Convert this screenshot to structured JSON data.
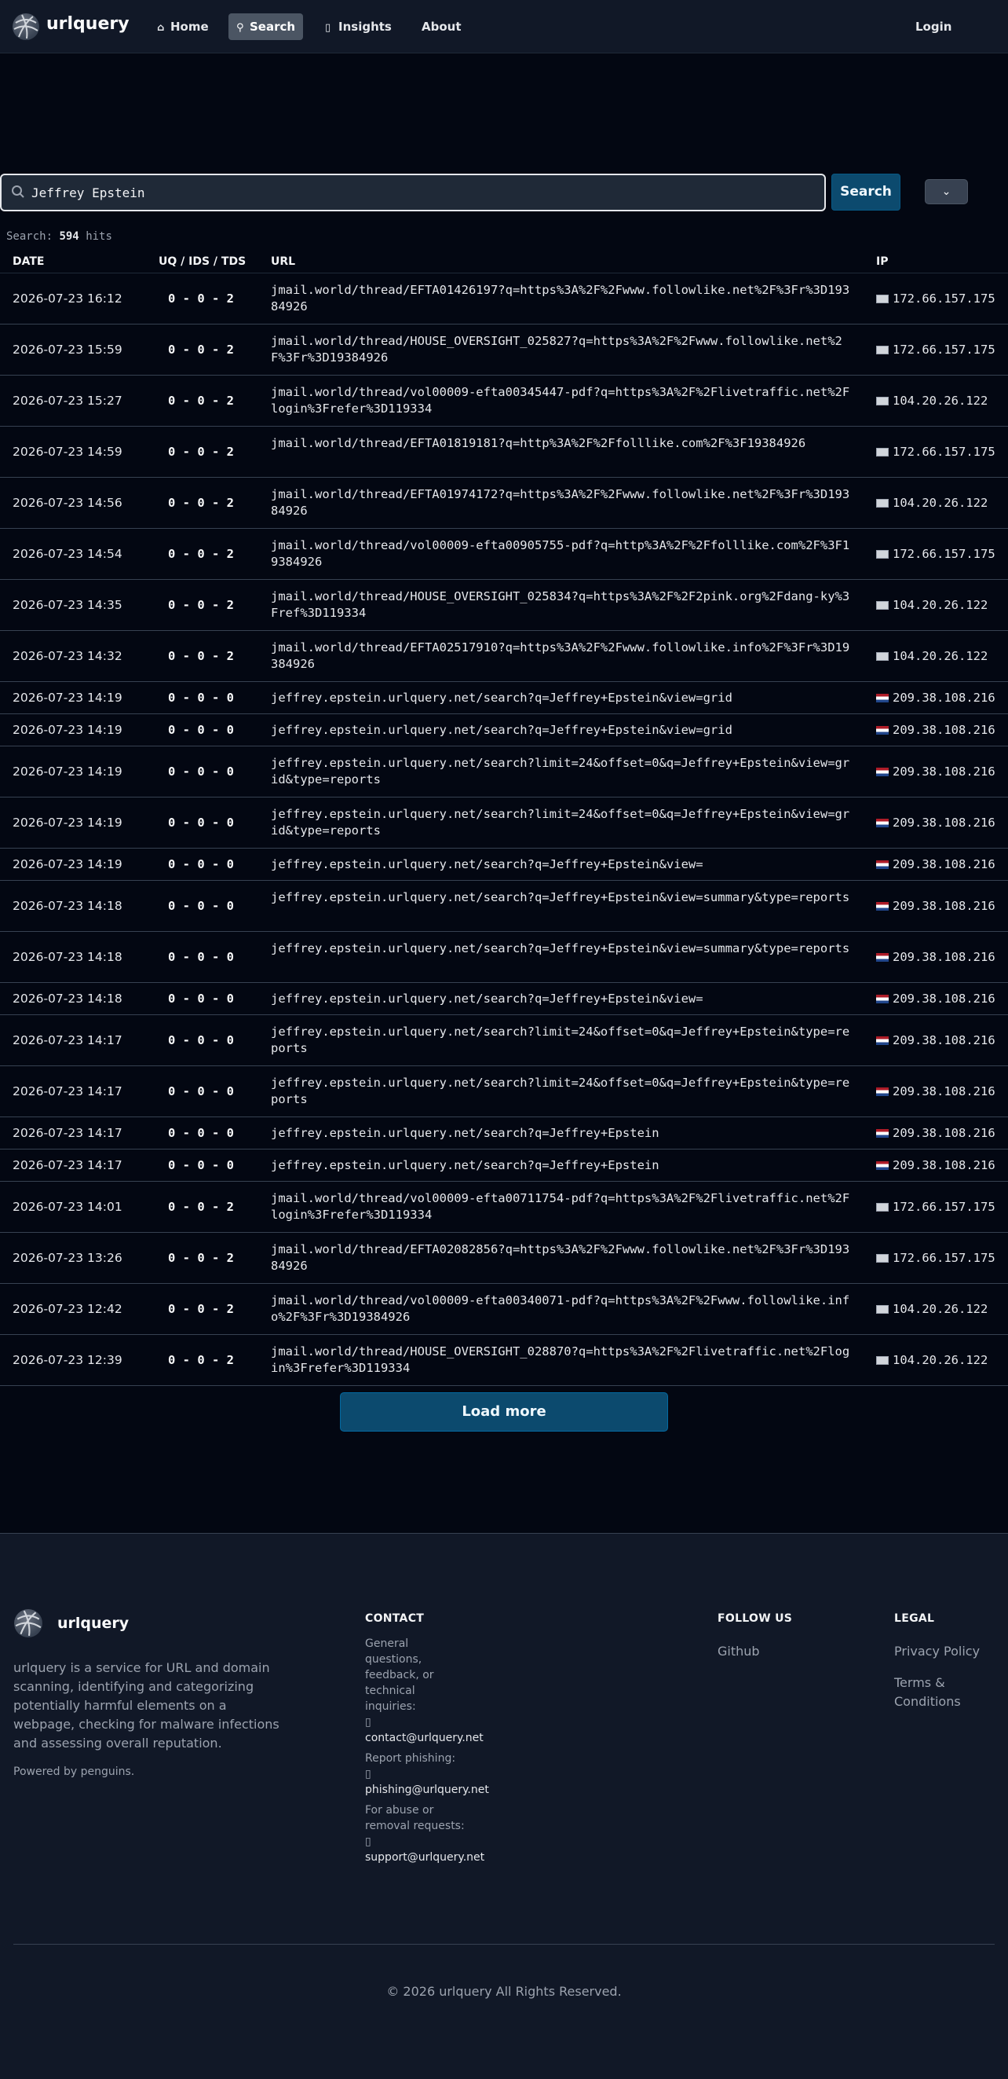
{
  "nav": {
    "brand": "urlquery",
    "items": [
      {
        "label": "Home",
        "icon": "home-icon"
      },
      {
        "label": "Search",
        "icon": "search-icon"
      },
      {
        "label": "Insights",
        "icon": "insights-icon"
      },
      {
        "label": "About",
        "icon": ""
      }
    ],
    "login": "Login"
  },
  "search": {
    "value": "Jeffrey Epstein",
    "button": "Search",
    "dropdown_icon": "chevron-down-icon",
    "hits_prefix": "Search:",
    "hits_count": "594",
    "hits_suffix": "hits"
  },
  "table": {
    "headers": [
      "DATE",
      "UQ / IDS / TDS",
      "URL",
      "IP"
    ],
    "rows": [
      {
        "date": "2026-07-23 16:12",
        "score": "0 - 0 - 2",
        "url": "jmail.world/thread/EFTA01426197?q=https%3A%2F%2Fwww.followlike.net%2F%3Fr%3D19384926",
        "ip": "172.66.157.175",
        "flag": "x"
      },
      {
        "date": "2026-07-23 15:59",
        "score": "0 - 0 - 2",
        "url": "jmail.world/thread/HOUSE_OVERSIGHT_025827?q=https%3A%2F%2Fwww.followlike.net%2F%3Fr%3D19384926",
        "ip": "172.66.157.175",
        "flag": "x"
      },
      {
        "date": "2026-07-23 15:27",
        "score": "0 - 0 - 2",
        "url": "jmail.world/thread/vol00009-efta00345447-pdf?q=https%3A%2F%2Flivetraffic.net%2Flogin%3Frefer%3D119334",
        "ip": "104.20.26.122",
        "flag": "x"
      },
      {
        "date": "2026-07-23 14:59",
        "score": "0 - 0 - 2",
        "url": "jmail.world/thread/EFTA01819181?q=http%3A%2F%2Ffolllike.com%2F%3F19384926",
        "ip": "172.66.157.175",
        "flag": "x"
      },
      {
        "date": "2026-07-23 14:56",
        "score": "0 - 0 - 2",
        "url": "jmail.world/thread/EFTA01974172?q=https%3A%2F%2Fwww.followlike.net%2F%3Fr%3D19384926",
        "ip": "104.20.26.122",
        "flag": "x"
      },
      {
        "date": "2026-07-23 14:54",
        "score": "0 - 0 - 2",
        "url": "jmail.world/thread/vol00009-efta00905755-pdf?q=http%3A%2F%2Ffolllike.com%2F%3F19384926",
        "ip": "172.66.157.175",
        "flag": "x"
      },
      {
        "date": "2026-07-23 14:35",
        "score": "0 - 0 - 2",
        "url": "jmail.world/thread/HOUSE_OVERSIGHT_025834?q=https%3A%2F%2F2pink.org%2Fdang-ky%3Fref%3D119334",
        "ip": "104.20.26.122",
        "flag": "x"
      },
      {
        "date": "2026-07-23 14:32",
        "score": "0 - 0 - 2",
        "url": "jmail.world/thread/EFTA02517910?q=https%3A%2F%2Fwww.followlike.info%2F%3Fr%3D19384926",
        "ip": "104.20.26.122",
        "flag": "x"
      },
      {
        "date": "2026-07-23 14:19",
        "score": "0 - 0 - 0",
        "url": "jeffrey.epstein.urlquery.net/search?q=Jeffrey+Epstein&view=grid",
        "ip": "209.38.108.216",
        "flag": "nl"
      },
      {
        "date": "2026-07-23 14:19",
        "score": "0 - 0 - 0",
        "url": "jeffrey.epstein.urlquery.net/search?q=Jeffrey+Epstein&view=grid",
        "ip": "209.38.108.216",
        "flag": "nl"
      },
      {
        "date": "2026-07-23 14:19",
        "score": "0 - 0 - 0",
        "url": "jeffrey.epstein.urlquery.net/search?limit=24&offset=0&q=Jeffrey+Epstein&view=grid&type=reports",
        "ip": "209.38.108.216",
        "flag": "nl"
      },
      {
        "date": "2026-07-23 14:19",
        "score": "0 - 0 - 0",
        "url": "jeffrey.epstein.urlquery.net/search?limit=24&offset=0&q=Jeffrey+Epstein&view=grid&type=reports",
        "ip": "209.38.108.216",
        "flag": "nl"
      },
      {
        "date": "2026-07-23 14:19",
        "score": "0 - 0 - 0",
        "url": "jeffrey.epstein.urlquery.net/search?q=Jeffrey+Epstein&view=",
        "ip": "209.38.108.216",
        "flag": "nl"
      },
      {
        "date": "2026-07-23 14:18",
        "score": "0 - 0 - 0",
        "url": "jeffrey.epstein.urlquery.net/search?q=Jeffrey+Epstein&view=summary&type=reports",
        "ip": "209.38.108.216",
        "flag": "nl"
      },
      {
        "date": "2026-07-23 14:18",
        "score": "0 - 0 - 0",
        "url": "jeffrey.epstein.urlquery.net/search?q=Jeffrey+Epstein&view=summary&type=reports",
        "ip": "209.38.108.216",
        "flag": "nl"
      },
      {
        "date": "2026-07-23 14:18",
        "score": "0 - 0 - 0",
        "url": "jeffrey.epstein.urlquery.net/search?q=Jeffrey+Epstein&view=",
        "ip": "209.38.108.216",
        "flag": "nl"
      },
      {
        "date": "2026-07-23 14:17",
        "score": "0 - 0 - 0",
        "url": "jeffrey.epstein.urlquery.net/search?limit=24&offset=0&q=Jeffrey+Epstein&type=reports",
        "ip": "209.38.108.216",
        "flag": "nl"
      },
      {
        "date": "2026-07-23 14:17",
        "score": "0 - 0 - 0",
        "url": "jeffrey.epstein.urlquery.net/search?limit=24&offset=0&q=Jeffrey+Epstein&type=reports",
        "ip": "209.38.108.216",
        "flag": "nl"
      },
      {
        "date": "2026-07-23 14:17",
        "score": "0 - 0 - 0",
        "url": "jeffrey.epstein.urlquery.net/search?q=Jeffrey+Epstein",
        "ip": "209.38.108.216",
        "flag": "nl"
      },
      {
        "date": "2026-07-23 14:17",
        "score": "0 - 0 - 0",
        "url": "jeffrey.epstein.urlquery.net/search?q=Jeffrey+Epstein",
        "ip": "209.38.108.216",
        "flag": "nl"
      },
      {
        "date": "2026-07-23 14:01",
        "score": "0 - 0 - 2",
        "url": "jmail.world/thread/vol00009-efta00711754-pdf?q=https%3A%2F%2Flivetraffic.net%2Flogin%3Frefer%3D119334",
        "ip": "172.66.157.175",
        "flag": "x"
      },
      {
        "date": "2026-07-23 13:26",
        "score": "0 - 0 - 2",
        "url": "jmail.world/thread/EFTA02082856?q=https%3A%2F%2Fwww.followlike.net%2F%3Fr%3D19384926",
        "ip": "172.66.157.175",
        "flag": "x"
      },
      {
        "date": "2026-07-23 12:42",
        "score": "0 - 0 - 2",
        "url": "jmail.world/thread/vol00009-efta00340071-pdf?q=https%3A%2F%2Fwww.followlike.info%2F%3Fr%3D19384926",
        "ip": "104.20.26.122",
        "flag": "x"
      },
      {
        "date": "2026-07-23 12:39",
        "score": "0 - 0 - 2",
        "url": "jmail.world/thread/HOUSE_OVERSIGHT_028870?q=https%3A%2F%2Flivetraffic.net%2Flogin%3Frefer%3D119334",
        "ip": "104.20.26.122",
        "flag": "x"
      }
    ],
    "load_more": "Load more"
  },
  "footer": {
    "brand": "urlquery",
    "description": "urlquery is a service for URL and domain scanning, identifying and categorizing potentially harmful elements on a webpage, checking for malware infections and assessing overall reputation.",
    "powered": "Powered by penguins.",
    "contact": {
      "heading": "CONTACT",
      "general_label": "General questions, feedback, or technical inquiries:",
      "general_email": "contact@urlquery.net",
      "phishing_label": "Report phishing:",
      "phishing_email": "phishing@urlquery.net",
      "abuse_label": "For abuse or removal requests:",
      "abuse_email": "support@urlquery.net",
      "glyph": "▯"
    },
    "follow": {
      "heading": "FOLLOW US",
      "github": "Github"
    },
    "legal": {
      "heading": "LEGAL",
      "privacy": "Privacy Policy",
      "terms": "Terms & Conditions"
    },
    "copyright": "© 2026 urlquery All Rights Reserved."
  },
  "colors": {
    "accent": "#0c4a6e",
    "background": "#030712",
    "footer": "#111827"
  }
}
